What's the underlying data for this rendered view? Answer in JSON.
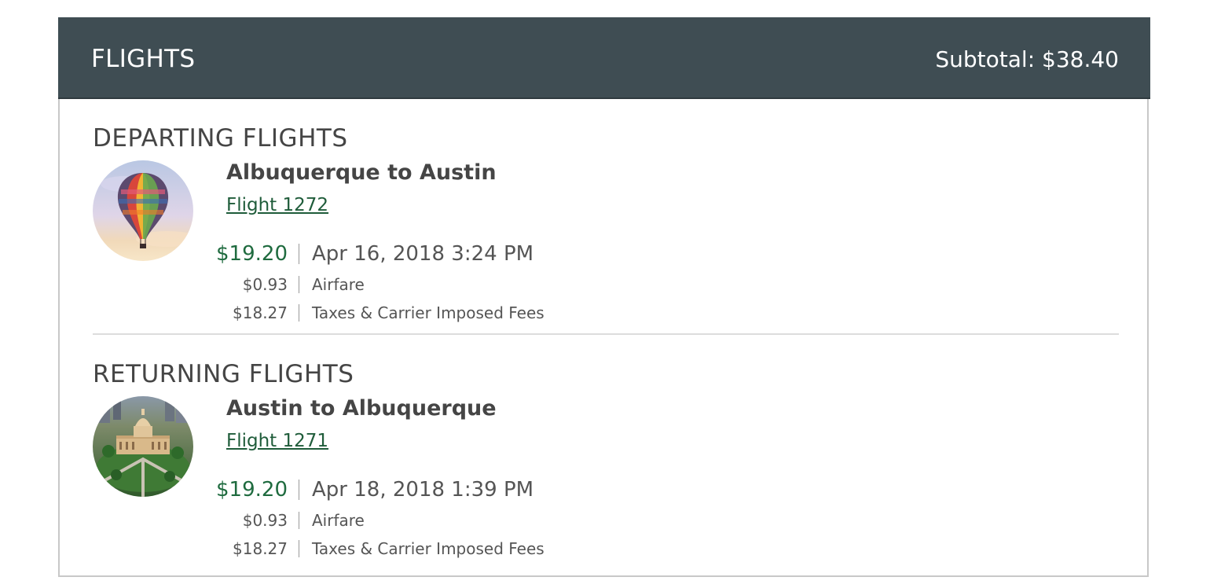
{
  "header": {
    "title": "FLIGHTS",
    "subtotal": "Subtotal: $38.40"
  },
  "departing": {
    "heading": "DEPARTING FLIGHTS",
    "route": "Albuquerque to Austin",
    "flight_link": "Flight 1272",
    "total": "$19.20",
    "datetime": "Apr 16, 2018 3:24 PM",
    "breakdown": [
      {
        "amount": "$0.93",
        "label": "Airfare"
      },
      {
        "amount": "$18.27",
        "label": "Taxes & Carrier Imposed Fees"
      }
    ],
    "image_icon": "hot-air-balloon-photo"
  },
  "returning": {
    "heading": "RETURNING FLIGHTS",
    "route": "Austin to Albuquerque",
    "flight_link": "Flight 1271",
    "total": "$19.20",
    "datetime": "Apr 18, 2018 1:39 PM",
    "breakdown": [
      {
        "amount": "$0.93",
        "label": "Airfare"
      },
      {
        "amount": "$18.27",
        "label": "Taxes & Carrier Imposed Fees"
      }
    ],
    "image_icon": "capitol-building-photo"
  },
  "colors": {
    "header_bg": "#3f4d53",
    "price_green": "#1f6b3f",
    "link_green": "#1f5c3a"
  }
}
